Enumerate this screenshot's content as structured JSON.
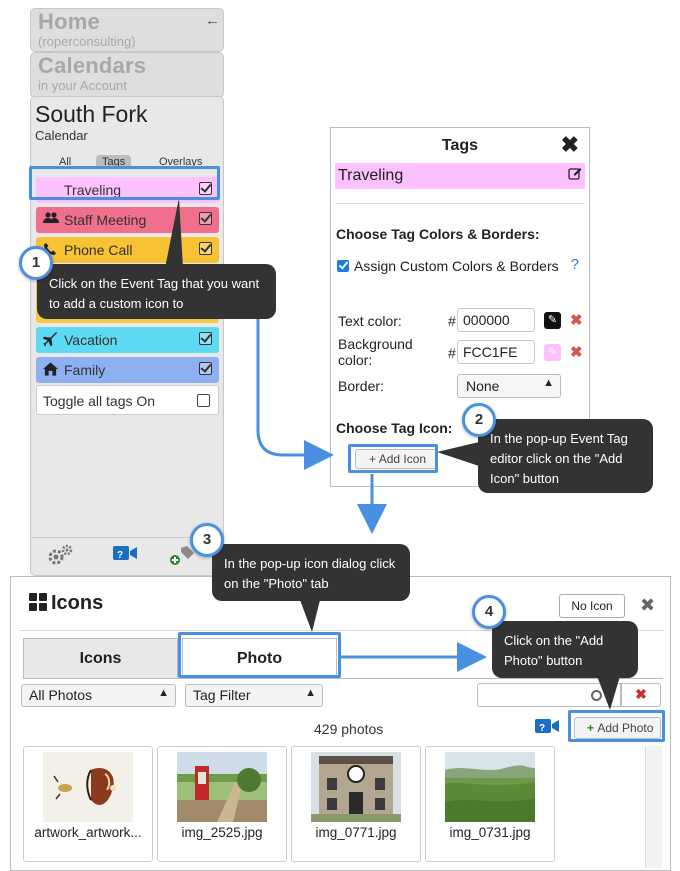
{
  "sidebar": {
    "home_title": "Home",
    "home_sub": "(roperconsulting)",
    "cal_title": "Calendars",
    "cal_sub": "in your Account",
    "cal_name": "South Fork",
    "cal_type": "Calendar",
    "tabs": [
      "All",
      "Tags",
      "Overlays"
    ],
    "active_tab": "Tags",
    "tags": [
      {
        "label": "Traveling",
        "color": "#fcc1fe",
        "icon": "none",
        "checked": true
      },
      {
        "label": "Staff Meeting",
        "color": "#f06f8c",
        "icon": "group-icon",
        "checked": true
      },
      {
        "label": "Phone Call",
        "color": "#f7c233",
        "icon": "phone-icon",
        "checked": true
      },
      {
        "label": "Vacation",
        "color": "#5ed9f2",
        "icon": "plane-icon",
        "checked": true
      },
      {
        "label": "Family",
        "color": "#8fb0f0",
        "icon": "home-icon",
        "checked": true
      }
    ],
    "toggle_label": "Toggle all tags On"
  },
  "tags_panel": {
    "title": "Tags",
    "tag_name": "Traveling",
    "section_colors": "Choose Tag Colors & Borders:",
    "assign_label": "Assign Custom Colors & Borders",
    "help": "?",
    "text_color_label": "Text color:",
    "text_color_value": "000000",
    "bg_color_label_1": "Background",
    "bg_color_label_2": "color:",
    "bg_color_value": "FCC1FE",
    "hash": "#",
    "border_label": "Border:",
    "border_value": "None",
    "section_icon": "Choose Tag Icon:",
    "add_icon_label": "Add Icon"
  },
  "icons_dialog": {
    "title": "Icons",
    "no_icon_label": "No Icon",
    "tabs": [
      "Icons",
      "Photo"
    ],
    "active_tab": "Photo",
    "filter_all": "All Photos",
    "filter_tag": "Tag Filter",
    "photo_count": "429 photos",
    "add_photo_label": "Add Photo",
    "photos": [
      {
        "name": "artwork_artwork..."
      },
      {
        "name": "img_2525.jpg"
      },
      {
        "name": "img_0771.jpg"
      },
      {
        "name": "img_0731.jpg"
      }
    ]
  },
  "callouts": [
    {
      "num": "1",
      "text": "Click on the Event Tag that you want to add a custom icon to"
    },
    {
      "num": "2",
      "text": "In the pop-up Event Tag editor click on the \"Add Icon\" button"
    },
    {
      "num": "3",
      "text": "In the pop-up icon dialog click on the \"Photo\" tab"
    },
    {
      "num": "4",
      "text": "Click on the \"Add Photo\" button"
    }
  ],
  "colors": {
    "accent_blue": "#4a90e2",
    "callout_bg": "#333333",
    "remove_red": "#d9534f"
  }
}
